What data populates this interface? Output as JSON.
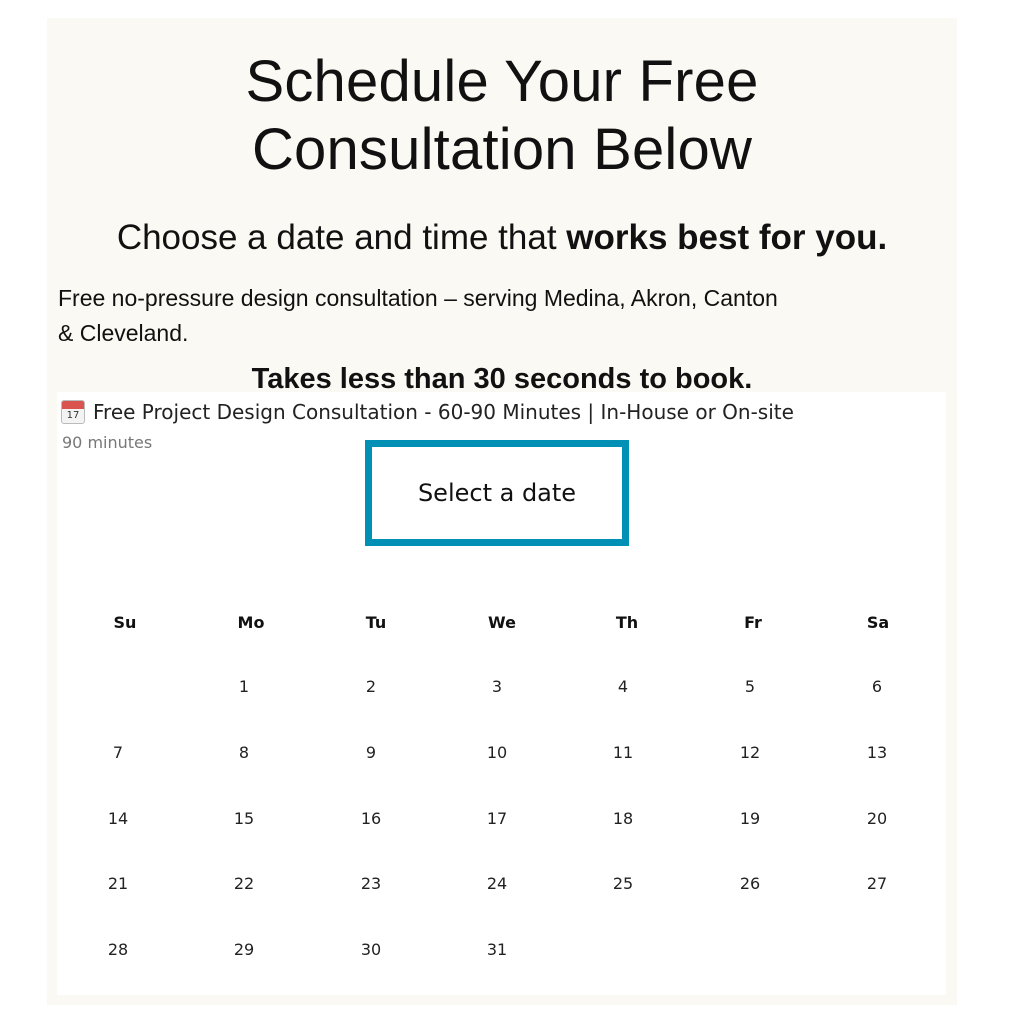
{
  "header": {
    "title_line1": "Schedule Your Free",
    "title_line2": "Consultation Below",
    "subtitle_regular": "Choose a date and time that ",
    "subtitle_bold": "works best for you.",
    "description_line1": "Free no-pressure design consultation – serving Medina, Akron, Canton",
    "description_line2": "& Cleveland.",
    "cta": "Takes less than 30 seconds to book."
  },
  "booking": {
    "event_icon": "calendar-17-icon",
    "event_icon_number": "17",
    "event_title": "Free Project Design Consultation - 60-90 Minutes | In-House or On-site",
    "duration": "90 minutes",
    "select_date_label": "Select a date",
    "accent_color": "#0090b5"
  },
  "calendar": {
    "weekdays": [
      "Su",
      "Mo",
      "Tu",
      "We",
      "Th",
      "Fr",
      "Sa"
    ],
    "first_weekday_index": 1,
    "days": [
      "1",
      "2",
      "3",
      "4",
      "5",
      "6",
      "7",
      "8",
      "9",
      "10",
      "11",
      "12",
      "13",
      "14",
      "15",
      "16",
      "17",
      "18",
      "19",
      "20",
      "21",
      "22",
      "23",
      "24",
      "25",
      "26",
      "27",
      "28",
      "29",
      "30",
      "31"
    ]
  }
}
